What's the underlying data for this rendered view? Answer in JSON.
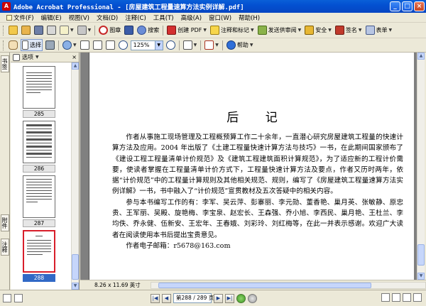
{
  "window": {
    "title": "Adobe Acrobat Professional - [房屋建筑工程量速算方法实例详解.pdf]",
    "controls": {
      "minimize": "_",
      "maximize": "□",
      "close": "×"
    }
  },
  "menu": [
    "文件(F)",
    "编辑(E)",
    "视图(V)",
    "文档(D)",
    "注释(C)",
    "工具(T)",
    "高级(A)",
    "窗口(W)",
    "帮助(H)"
  ],
  "toolbar1": {
    "tuzhang": "图章",
    "search": "搜索",
    "create_pdf": "创建 PDF",
    "comment_markup": "注释和标记",
    "send_review": "发送供审阅",
    "security": "安全",
    "sign": "签名",
    "form": "表单"
  },
  "toolbar2": {
    "select": "选择",
    "zoom": "125%",
    "help": "帮助"
  },
  "navtabs": {
    "bookmarks": "书签",
    "attachments": "附件",
    "comments": "注释"
  },
  "thumbpane": {
    "options": "选项",
    "thumbs": [
      {
        "label": "285"
      },
      {
        "label": "286"
      },
      {
        "label": "287"
      },
      {
        "label": "288"
      }
    ]
  },
  "document": {
    "title": "后 记",
    "paragraphs": [
      "作者从事施工现场管理及工程概预算工作二十余年，一直潜心研究房屋建筑工程量的快速计算方法及应用。2004 年出版了《土建工程量快速计算方法与技巧》一书，在此期间国家颁布了《建设工程工程量清单计价规范》及《建筑工程建筑面积计算规范》，为了适应新的工程计价需要，使读者掌握在工程量清单计价方式下，工程量快速计算方法及要点，作者又历时两年，依据“计价规范”中的工程量计算规则及其他相关规范、规则，编写了《房屋建筑工程量速算方法实例详解》一书，书中融入了“计价规范”宣贯教材及五次答疑中的相关内容。",
      "参与本书编写工作的有：李军、吴云萍、彭寨丽、李元勋、董香艳、巢月英、张敏静、原忠贵、王军丽、吴殿、旋艳梅、李宝泉、赵宏长、王森强、乔小旭、李西民、巢月艳、王杜兰、李均佚、乔永健、伍新安、王宏年、王春娥、刘彩玲、刘红梅等，在此一并表示感谢。欢迎广大读者在阅读使用本书后提出宝贵意见。",
      "作者电子邮箱：r5678@163.com"
    ]
  },
  "status": {
    "page_size": "8.26 x 11.69 英寸",
    "page_indicator": "第288 / 289 页"
  }
}
